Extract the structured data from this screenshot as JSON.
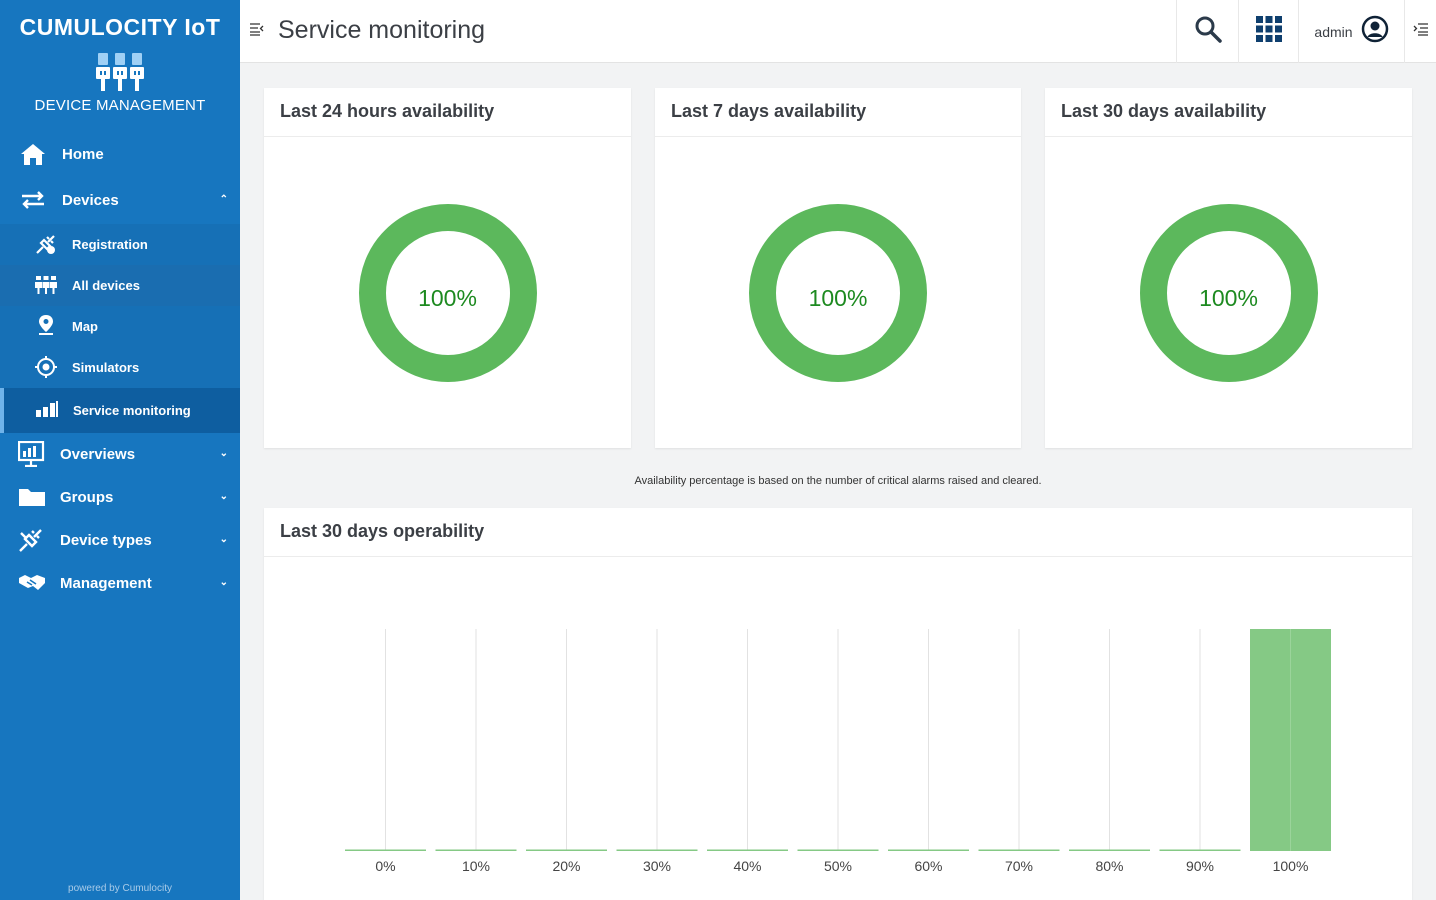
{
  "brand": {
    "title": "CUMULOCITY IoT",
    "subtitle": "DEVICE MANAGEMENT",
    "powered_by": "powered by Cumulocity"
  },
  "sidebar": {
    "items": [
      {
        "label": "Home",
        "icon": "home-icon"
      },
      {
        "label": "Devices",
        "icon": "arrows-exchange-icon",
        "expanded": true
      },
      {
        "label": "Registration",
        "icon": "plug-icon"
      },
      {
        "label": "All devices",
        "icon": "devices-icon"
      },
      {
        "label": "Map",
        "icon": "map-marker-icon"
      },
      {
        "label": "Simulators",
        "icon": "simulator-icon"
      },
      {
        "label": "Service monitoring",
        "icon": "bar-chart-icon",
        "active": true
      },
      {
        "label": "Overviews",
        "icon": "dashboard-icon"
      },
      {
        "label": "Groups",
        "icon": "folder-icon"
      },
      {
        "label": "Device types",
        "icon": "plug-icon"
      },
      {
        "label": "Management",
        "icon": "handshake-icon"
      }
    ]
  },
  "header": {
    "title": "Service monitoring",
    "user": "admin"
  },
  "availability": [
    {
      "title": "Last 24 hours availability",
      "value": "100%",
      "percent": 100
    },
    {
      "title": "Last 7 days availability",
      "value": "100%",
      "percent": 100
    },
    {
      "title": "Last 30 days availability",
      "value": "100%",
      "percent": 100
    }
  ],
  "note": "Availability percentage is based on the number of critical alarms raised and cleared.",
  "operability": {
    "title": "Last 30 days operability"
  },
  "colors": {
    "sidebar": "#1776bf",
    "donut": "#5cb85c",
    "bar": "#85c985",
    "text_green": "#1d8a20"
  },
  "chart_data": {
    "type": "bar",
    "categories": [
      "0%",
      "10%",
      "20%",
      "30%",
      "40%",
      "50%",
      "60%",
      "70%",
      "80%",
      "90%",
      "100%"
    ],
    "values": [
      0,
      0,
      0,
      0,
      0,
      0,
      0,
      0,
      0,
      0,
      1
    ],
    "title": "Last 30 days operability",
    "xlabel": "",
    "ylabel": "",
    "ylim": [
      0,
      1
    ],
    "grid": true
  }
}
